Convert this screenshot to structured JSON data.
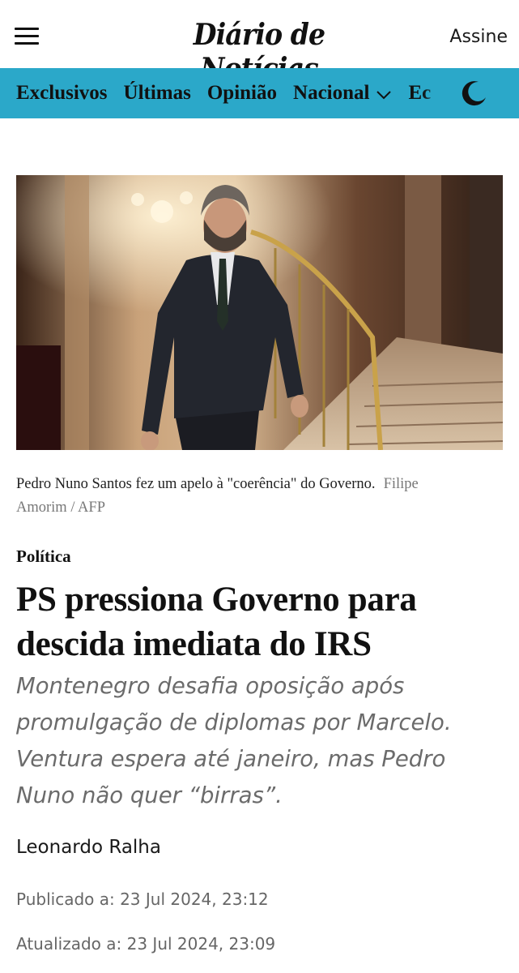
{
  "header": {
    "logo": "Diário de Notícias",
    "subscribe_label": "Assine",
    "menu_icon": "hamburger-menu-icon"
  },
  "nav": {
    "items": [
      {
        "label": "Exclusivos"
      },
      {
        "label": "Últimas"
      },
      {
        "label": "Opinião"
      },
      {
        "label": "Nacional",
        "has_dropdown": true
      },
      {
        "label": "Ec"
      }
    ],
    "theme_toggle_icon": "moon-icon",
    "colors": {
      "bar": "#2ba8c9"
    }
  },
  "article": {
    "image_alt": "Pedro Nuno Santos fez um apelo à \"coerência\" do Governo.",
    "caption": "Pedro Nuno Santos fez um apelo à \"coerência\" do Governo.",
    "credit": "Filipe Amorim / AFP",
    "section": "Política",
    "headline": "PS pressiona Governo para descida imediata do IRS",
    "lead": "Montenegro desafia oposição após promulgação de diplomas por Marcelo. Ventura espera até janeiro, mas Pedro Nuno não quer “birras”.",
    "author": "Leonardo Ralha",
    "published": "Publicado a: 23 Jul 2024, 23:12",
    "updated": "Atualizado a: 23 Jul 2024, 23:09"
  }
}
